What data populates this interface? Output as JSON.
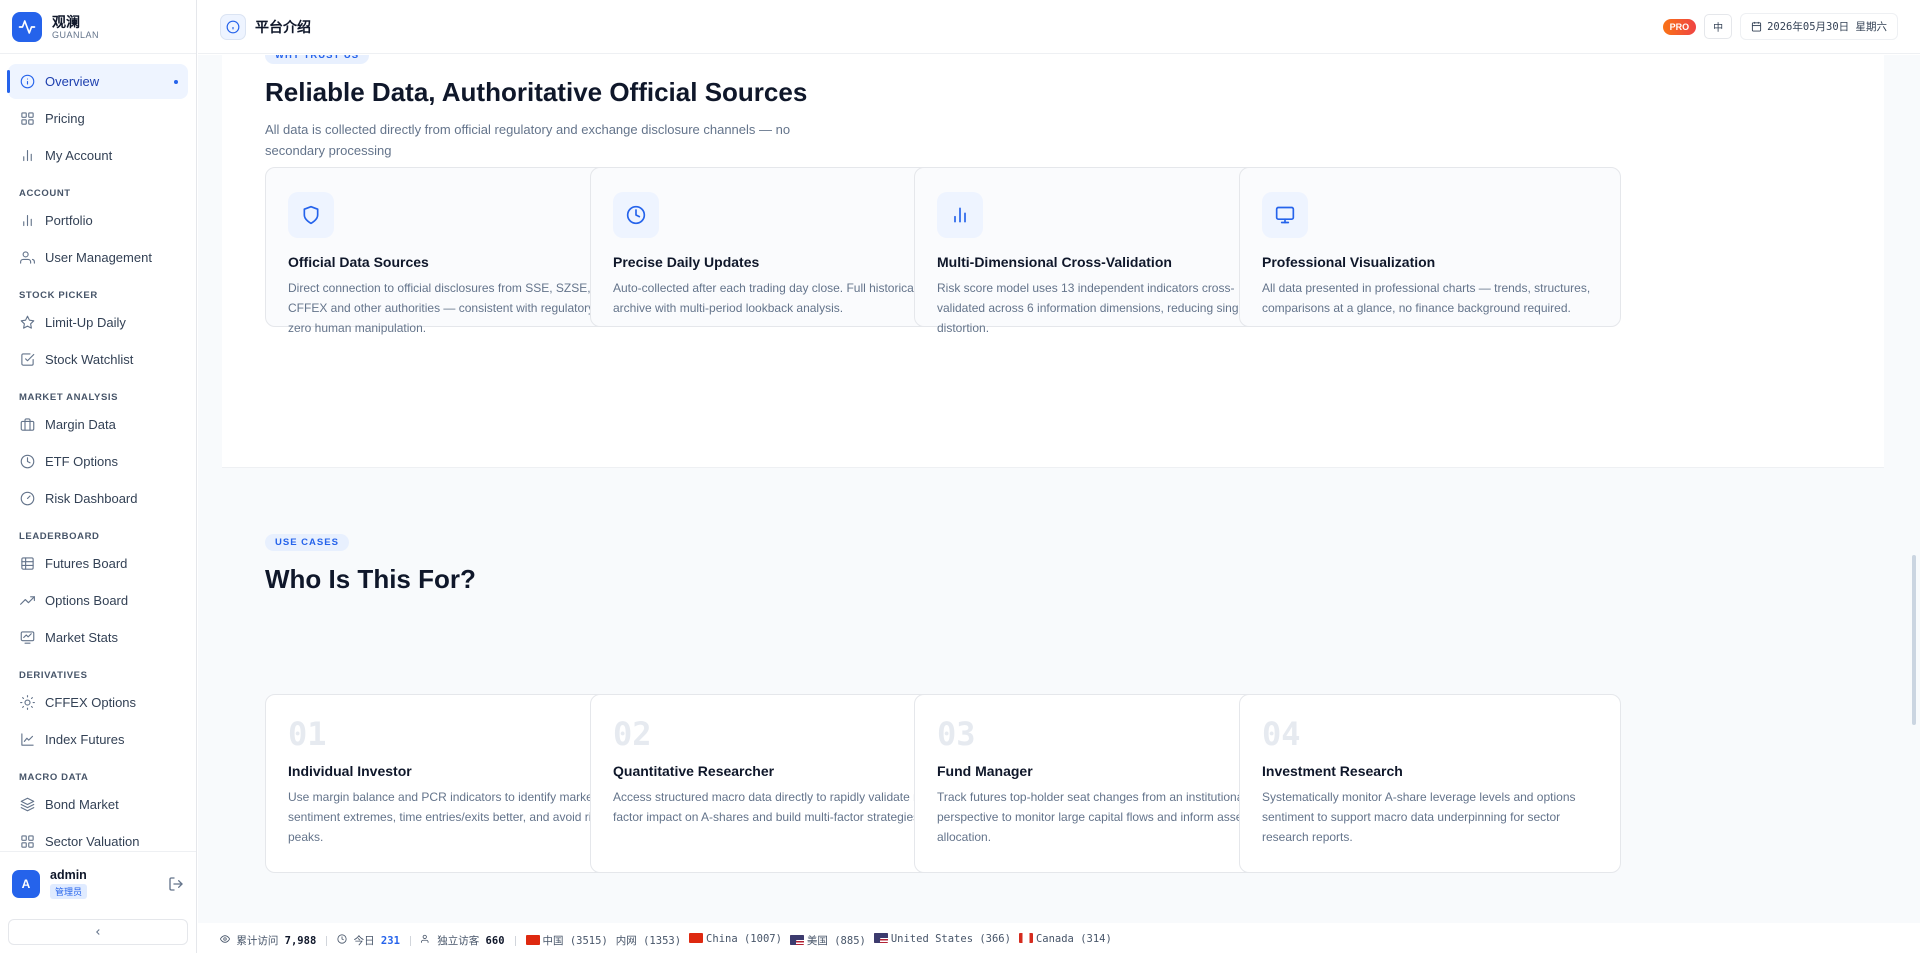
{
  "brand": {
    "name": "观澜",
    "sub": "GUANLAN"
  },
  "nav": {
    "top": [
      {
        "key": "overview",
        "label": "Overview",
        "icon": "info-circle-icon",
        "active": true
      },
      {
        "key": "pricing",
        "label": "Pricing",
        "icon": "grid-icon"
      },
      {
        "key": "my-account",
        "label": "My Account",
        "icon": "bar-chart-icon"
      }
    ],
    "sections": [
      {
        "title": "ACCOUNT",
        "items": [
          {
            "key": "portfolio",
            "label": "Portfolio",
            "icon": "bar-chart-icon"
          },
          {
            "key": "user-management",
            "label": "User Management",
            "icon": "users-icon"
          }
        ]
      },
      {
        "title": "STOCK PICKER",
        "items": [
          {
            "key": "limit-up-daily",
            "label": "Limit-Up Daily",
            "icon": "star-icon"
          },
          {
            "key": "stock-watchlist",
            "label": "Stock Watchlist",
            "icon": "checkbox-icon"
          }
        ]
      },
      {
        "title": "MARKET ANALYSIS",
        "items": [
          {
            "key": "margin-data",
            "label": "Margin Data",
            "icon": "briefcase-icon"
          },
          {
            "key": "etf-options",
            "label": "ETF Options",
            "icon": "clock-icon"
          },
          {
            "key": "risk-dashboard",
            "label": "Risk Dashboard",
            "icon": "gauge-icon"
          }
        ]
      },
      {
        "title": "LEADERBOARD",
        "items": [
          {
            "key": "futures-board",
            "label": "Futures Board",
            "icon": "table-icon"
          },
          {
            "key": "options-board",
            "label": "Options Board",
            "icon": "trending-up-icon"
          },
          {
            "key": "market-stats",
            "label": "Market Stats",
            "icon": "monitor-chart-icon"
          }
        ]
      },
      {
        "title": "DERIVATIVES",
        "items": [
          {
            "key": "cffex-options",
            "label": "CFFEX Options",
            "icon": "sun-icon"
          },
          {
            "key": "index-futures",
            "label": "Index Futures",
            "icon": "line-chart-icon"
          }
        ]
      },
      {
        "title": "MACRO DATA",
        "items": [
          {
            "key": "bond-market",
            "label": "Bond Market",
            "icon": "layers-icon"
          },
          {
            "key": "sector-valuation",
            "label": "Sector Valuation",
            "icon": "grid-icon"
          }
        ]
      }
    ]
  },
  "user": {
    "initial": "A",
    "name": "admin",
    "role": "管理员"
  },
  "header": {
    "title": "平台介绍",
    "badge": "PRO",
    "lang": "中",
    "date": "2026年05月30日 星期六"
  },
  "trust": {
    "eyebrow": "WHY TRUST US",
    "title": "Reliable Data, Authoritative Official Sources",
    "desc": "All data is collected directly from official regulatory and exchange disclosure channels — no secondary processing",
    "cards": [
      {
        "title": "Official Data Sources",
        "desc": "Direct connection to official disclosures from SSE, SZSE, CFFEX and other authorities — consistent with regulatory data, zero human manipulation.",
        "icon": "shield-icon"
      },
      {
        "title": "Precise Daily Updates",
        "desc": "Auto-collected after each trading day close. Full historical archive with multi-period lookback analysis.",
        "icon": "clock-icon"
      },
      {
        "title": "Multi-Dimensional Cross-Validation",
        "desc": "Risk score model uses 13 independent indicators cross-validated across 6 information dimensions, reducing single-data distortion.",
        "icon": "bar-chart-icon"
      },
      {
        "title": "Professional Visualization",
        "desc": "All data presented in professional charts — trends, structures, comparisons at a glance, no finance background required.",
        "icon": "monitor-icon"
      }
    ]
  },
  "usecases": {
    "eyebrow": "USE CASES",
    "title": "Who Is This For?",
    "cards": [
      {
        "num": "01",
        "title": "Individual Investor",
        "desc": "Use margin balance and PCR indicators to identify market sentiment extremes, time entries/exits better, and avoid risk peaks."
      },
      {
        "num": "02",
        "title": "Quantitative Researcher",
        "desc": "Access structured macro data directly to rapidly validate macro factor impact on A-shares and build multi-factor strategies."
      },
      {
        "num": "03",
        "title": "Fund Manager",
        "desc": "Track futures top-holder seat changes from an institutional perspective to monitor large capital flows and inform asset allocation."
      },
      {
        "num": "04",
        "title": "Investment Research",
        "desc": "Systematically monitor A-share leverage levels and options sentiment to support macro data underpinning for sector research reports."
      }
    ]
  },
  "footer": {
    "total_label": "累计访问",
    "total": "7,988",
    "today_label": "今日",
    "today": "231",
    "unique_label": "独立访客",
    "unique": "660",
    "geo": [
      {
        "flag": "cn",
        "text": "中国 (3515)"
      },
      {
        "flag": "",
        "text": "内网 (1353)"
      },
      {
        "flag": "cn",
        "text": "China (1007)"
      },
      {
        "flag": "us",
        "text": "美国 (885)"
      },
      {
        "flag": "us",
        "text": "United States (366)"
      },
      {
        "flag": "ca",
        "text": "Canada (314)"
      }
    ]
  }
}
